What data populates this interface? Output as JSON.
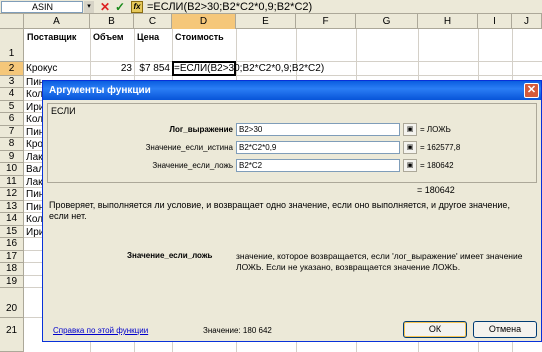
{
  "formula_bar": {
    "name_box": "ASIN",
    "drop_glyph": "▾",
    "cancel_glyph": "✕",
    "enter_glyph": "✓",
    "fx_glyph": "fx",
    "formula": "=ЕСЛИ(B2>30;B2*C2*0,9;B2*C2)"
  },
  "columns": [
    "A",
    "B",
    "C",
    "D",
    "E",
    "F",
    "G",
    "H",
    "I",
    "J"
  ],
  "rows": [
    "1",
    "2",
    "3",
    "4",
    "5",
    "6",
    "7",
    "8",
    "9",
    "10",
    "11",
    "12",
    "13",
    "14",
    "15",
    "16",
    "17",
    "18",
    "19",
    "20",
    "21"
  ],
  "sheet": {
    "headers": [
      "Поставщик",
      "Объем",
      "Цена",
      "Стоимость"
    ],
    "row2": {
      "a": "Крокус",
      "b": "23",
      "c": "$7 854",
      "d": "=ЕСЛИ(B2>30;B2*C2*0,9;B2*C2)"
    },
    "col_a_partial": [
      "Пин",
      "Кол",
      "Ири",
      "Кол",
      "Пин",
      "Кро",
      "Лак",
      "Вал",
      "Лак",
      "Пин",
      "Пин",
      "Кол",
      "Ири"
    ]
  },
  "dialog": {
    "title": "Аргументы функции",
    "close_glyph": "✕",
    "function_name": "ЕСЛИ",
    "args": [
      {
        "label": "Лог_выражение",
        "value": "B2>30",
        "result": "= ЛОЖЬ"
      },
      {
        "label": "Значение_если_истина",
        "value": "B2*C2*0,9",
        "result": "= 162577,8"
      },
      {
        "label": "Значение_если_ложь",
        "value": "B2*C2",
        "result": "= 180642"
      }
    ],
    "total": "= 180642",
    "description": "Проверяет, выполняется ли условие, и возвращает одно значение, если оно выполняется, и другое значение, если нет.",
    "arg_help_name": "Значение_если_ложь",
    "arg_help_text": "значение, которое возвращается, если 'лог_выражение' имеет значение ЛОЖЬ. Если не указано, возвращается значение ЛОЖЬ.",
    "help_link": "Справка по этой функции",
    "value_text": "Значение: 180 642",
    "ok": "ОК",
    "cancel": "Отмена",
    "ref_glyph": "▣"
  }
}
